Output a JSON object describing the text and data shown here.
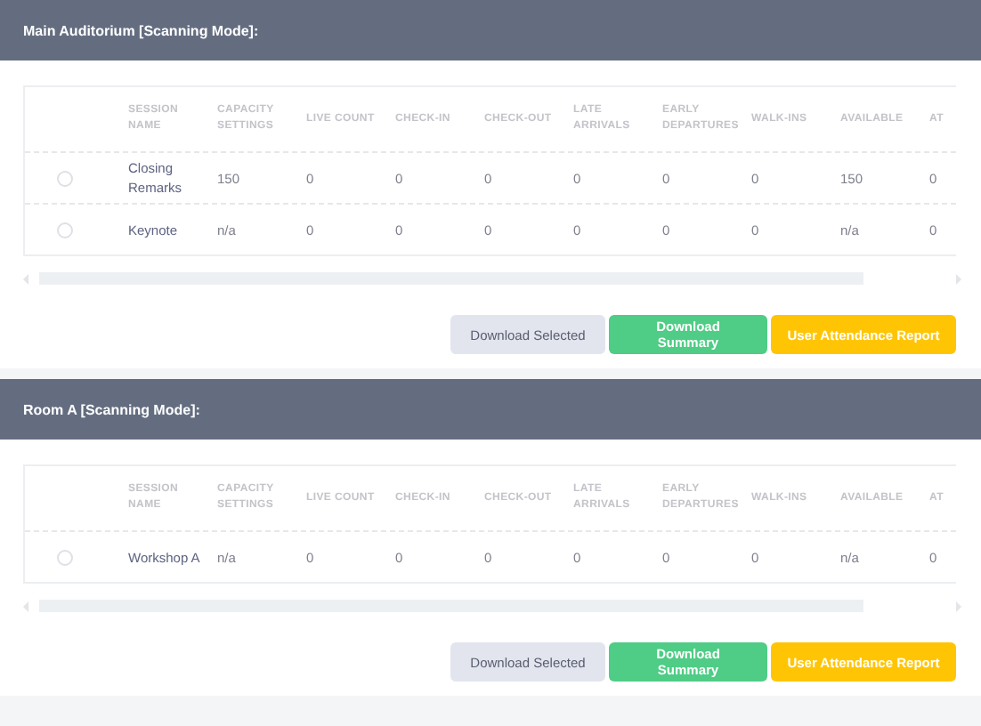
{
  "sections": [
    {
      "title": "Main Auditorium [Scanning Mode]:",
      "table": {
        "columns": [
          "SESSION NAME",
          "CAPACITY SETTINGS",
          "LIVE COUNT",
          "CHECK-IN",
          "CHECK-OUT",
          "LATE ARRIVALS",
          "EARLY DEPARTURES",
          "WALK-INS",
          "AVAILABLE",
          "AT"
        ],
        "rows": [
          {
            "selected": false,
            "cells": [
              "Closing Remarks",
              "150",
              "0",
              "0",
              "0",
              "0",
              "0",
              "0",
              "150",
              "0"
            ]
          },
          {
            "selected": false,
            "cells": [
              "Keynote",
              "n/a",
              "0",
              "0",
              "0",
              "0",
              "0",
              "0",
              "n/a",
              "0"
            ]
          }
        ]
      },
      "buttons": [
        {
          "label": "Download Selected",
          "kind": "neutral"
        },
        {
          "label": "Download Summary",
          "kind": "success"
        },
        {
          "label": "User Attendance Report",
          "kind": "warning"
        }
      ]
    },
    {
      "title": "Room A [Scanning Mode]:",
      "table": {
        "columns": [
          "SESSION NAME",
          "CAPACITY SETTINGS",
          "LIVE COUNT",
          "CHECK-IN",
          "CHECK-OUT",
          "LATE ARRIVALS",
          "EARLY DEPARTURES",
          "WALK-INS",
          "AVAILABLE",
          "AT"
        ],
        "rows": [
          {
            "selected": false,
            "cells": [
              "Workshop A",
              "n/a",
              "0",
              "0",
              "0",
              "0",
              "0",
              "0",
              "n/a",
              "0"
            ]
          }
        ]
      },
      "buttons": [
        {
          "label": "Download Selected",
          "kind": "neutral"
        },
        {
          "label": "Download Summary",
          "kind": "success"
        },
        {
          "label": "User Attendance Report",
          "kind": "warning"
        }
      ]
    }
  ]
}
